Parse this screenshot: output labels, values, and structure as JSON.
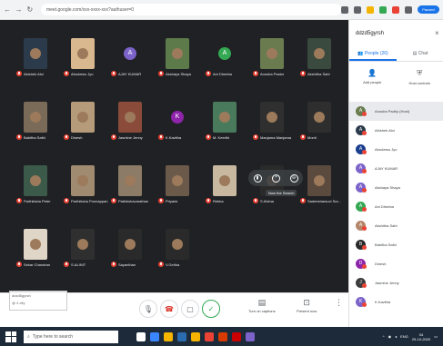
{
  "browser": {
    "url": "meet.google.com/xxx-xxxx-xxx?authuser=0",
    "profile_label": "Paused"
  },
  "meeting": {
    "code": "ddzd5gyrsh",
    "info_line2": "@ 4 city",
    "tooltip": "Now the Search"
  },
  "participants": [
    {
      "name": "Abishek Aloi",
      "kind": "photo",
      "color": "#2b3b4b"
    },
    {
      "name": "Abudarsu Jyo",
      "kind": "photo",
      "color": "#d9b88f"
    },
    {
      "name": "AJAY KUMAR",
      "kind": "avatar",
      "initial": "A",
      "color": "#7b63c9"
    },
    {
      "name": "Akshaya Shaya",
      "kind": "photo",
      "color": "#5c7a4a"
    },
    {
      "name": "Ani Dheeba",
      "kind": "avatar",
      "initial": "A",
      "color": "#34a853"
    },
    {
      "name": "Anusha Pastor",
      "kind": "photo",
      "color": "#6a7c4f"
    },
    {
      "name": "Akshitha Sabi",
      "kind": "photo",
      "color": "#3a4a3e"
    },
    {
      "name": "Babitha Sathi",
      "kind": "photo",
      "color": "#7a6a58"
    },
    {
      "name": "Dinesh",
      "kind": "photo",
      "color": "#b59b7a"
    },
    {
      "name": "Jasmine Jenny",
      "kind": "photo",
      "color": "#8a4b3b"
    },
    {
      "name": "K.Kavitha",
      "kind": "avatar",
      "initial": "K",
      "color": "#8e24aa"
    },
    {
      "name": "M. Keerthi",
      "kind": "photo",
      "color": "#4a7a5c"
    },
    {
      "name": "Manjama Manjama",
      "kind": "photo",
      "color": "#2f2f2f"
    },
    {
      "name": "Monti",
      "kind": "photo",
      "color": "#2e2e2e"
    },
    {
      "name": "Parthiksha Peter",
      "kind": "photo",
      "color": "#3c5a4a"
    },
    {
      "name": "Parthiksha Ponnappan",
      "kind": "photo",
      "color": "#a08a70"
    },
    {
      "name": "Pathikshavarathan",
      "kind": "photo",
      "color": "#8c7b66"
    },
    {
      "name": "Priyank",
      "kind": "photo",
      "color": "#6b5a4a"
    },
    {
      "name": "Rekha",
      "kind": "photo",
      "color": "#c9b8a0"
    },
    {
      "name": "S Ahima",
      "kind": "photo",
      "color": "#2a2a2a"
    },
    {
      "name": "Sadeesharsuvi Sur...",
      "kind": "photo",
      "color": "#5b4a3e"
    },
    {
      "name": "Sekar Chandran",
      "kind": "photo",
      "color": "#e0d6c8"
    },
    {
      "name": "S.ALINIT",
      "kind": "photo",
      "color": "#2f2f2f"
    },
    {
      "name": "Sayanthan",
      "kind": "photo",
      "color": "#2a2a2a"
    },
    {
      "name": "V.Geitha",
      "kind": "photo",
      "color": "#2a2a2a"
    }
  ],
  "controls": {
    "turn_on_captions": "Turn on captions",
    "present_now": "Present now"
  },
  "side_panel": {
    "title": "ddzd5gyrsh",
    "tab_people": "People (26)",
    "tab_chat": "Chat",
    "add_people": "Add people",
    "host_controls": "Host controls",
    "people": [
      {
        "name": "Anusha Padhy (Host)",
        "initial": "A",
        "color": "#6a7c4f",
        "highlight": true
      },
      {
        "name": "Abishek Aloi",
        "initial": "A",
        "color": "#2b3b4b"
      },
      {
        "name": "Abudarsu Jyo",
        "initial": "A",
        "color": "#1a3e8e"
      },
      {
        "name": "AJAY KUMAR",
        "initial": "A",
        "color": "#7b63c9"
      },
      {
        "name": "Akshaya Shaya",
        "initial": "A",
        "color": "#7b63c9"
      },
      {
        "name": "Ani Dheeba",
        "initial": "A",
        "color": "#34a853"
      },
      {
        "name": "Akshitha Sabi",
        "initial": "A",
        "color": "#b5876a"
      },
      {
        "name": "Babitha Sathi",
        "initial": "B",
        "color": "#2a2a2a"
      },
      {
        "name": "Dinesh",
        "initial": "D",
        "color": "#8e24aa"
      },
      {
        "name": "Jasmine Jenny",
        "initial": "J",
        "color": "#3c3c3c"
      },
      {
        "name": "K.Kavitha",
        "initial": "K",
        "color": "#7b63c9"
      }
    ]
  },
  "taskbar": {
    "search_placeholder": "Type here to search",
    "language": "ENG",
    "time": "04",
    "date": "29-10-2020"
  }
}
